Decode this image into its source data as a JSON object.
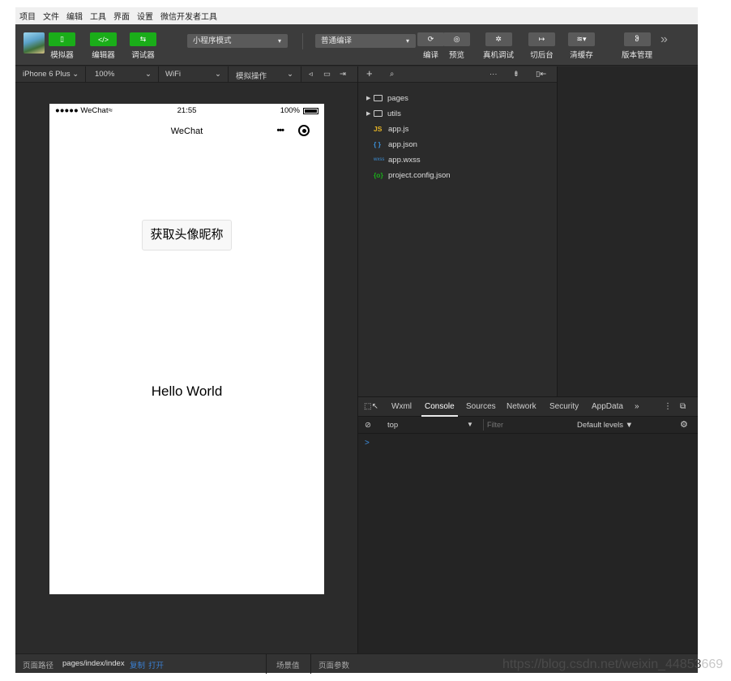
{
  "menubar": {
    "items": [
      "项目",
      "文件",
      "编辑",
      "工具",
      "界面",
      "设置",
      "微信开发者工具"
    ]
  },
  "toolbar": {
    "simulator_label": "模拟器",
    "simulator_icon": "▯",
    "editor_label": "编辑器",
    "editor_icon": "</>",
    "debugger_label": "调试器",
    "debugger_icon": "⇆",
    "mode_select": "小程序模式",
    "compile_select": "普通编译",
    "compile_label": "编译",
    "preview_label": "预览",
    "remote_debug_label": "真机调试",
    "background_label": "切后台",
    "clear_cache_label": "清缓存",
    "version_label": "版本管理",
    "more_icon": "»"
  },
  "subbar": {
    "device": "iPhone 6 Plus ⌄",
    "zoom": "100%",
    "network": "WiFi",
    "simulate_op": "模拟操作",
    "caret": "⌄"
  },
  "phone": {
    "carrier": "●●●●● WeChat",
    "time": "21:55",
    "battery": "100%",
    "nav_title": "WeChat",
    "capsule_dots": "•••",
    "get_info_button": "获取头像昵称",
    "hello_text": "Hello World"
  },
  "filetree": {
    "items": [
      {
        "name": "pages",
        "icon": "",
        "type": "folder"
      },
      {
        "name": "utils",
        "icon": "",
        "type": "folder"
      },
      {
        "name": "app.js",
        "icon": "JS",
        "type": "js"
      },
      {
        "name": "app.json",
        "icon": "{ }",
        "type": "json"
      },
      {
        "name": "app.wxss",
        "icon": "wxss",
        "type": "wxss"
      },
      {
        "name": "project.config.json",
        "icon": "{o}",
        "type": "config"
      }
    ]
  },
  "devtools": {
    "tabs": [
      "Wxml",
      "Console",
      "Sources",
      "Network",
      "Security",
      "AppData"
    ],
    "active_tab": "Console",
    "more": "»",
    "context": "top",
    "filter_placeholder": "Filter",
    "levels": "Default levels ▼",
    "prompt": ">"
  },
  "statusbar": {
    "path_label": "页面路径",
    "path_value": "pages/index/index",
    "copy_label": "复制",
    "open_label": "打开",
    "scene_label": "场景值",
    "params_label": "页面参数"
  },
  "watermark": {
    "text": "https://blog.csdn.net/weixin_44853",
    "faded": "669"
  },
  "colors": {
    "accent_green": "#1aad19",
    "link_blue": "#3a7fd2",
    "background": "#2b2b2b",
    "toolbar": "#3c3c3c"
  }
}
